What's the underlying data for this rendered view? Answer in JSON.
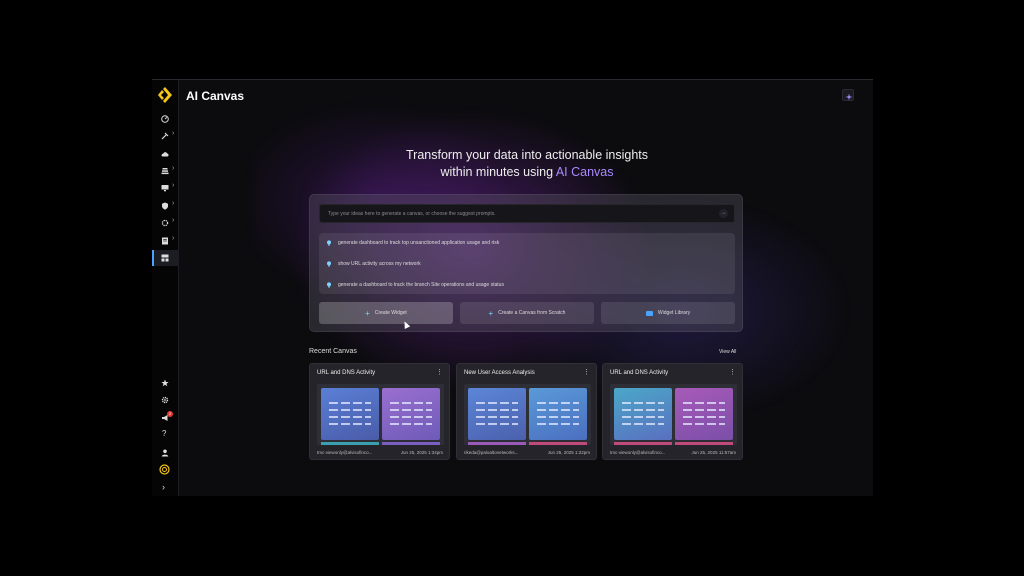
{
  "app": {
    "title": "AI Canvas"
  },
  "hero": {
    "line1": "Transform your data into actionable insights",
    "line2_prefix": "within minutes using ",
    "line2_accent": "AI Canvas"
  },
  "prompt": {
    "placeholder": "Type your ideas here to generate a canvas, or choose the suggest prompts."
  },
  "suggestions": [
    "generate dashboard to track top unsanctioned application usage and risk",
    "show URL activity across my network",
    "generate a dashboard to track the branch Site operations and usage status"
  ],
  "actions": {
    "create_widget": "Create Widget",
    "create_canvas": "Create a Canvas from Scratch",
    "widget_library": "Widget Library"
  },
  "recent": {
    "title": "Recent Canvas",
    "view_all": "View All",
    "cards": [
      {
        "title": "URL and DNS Activity",
        "owner": "tmc-viewonly@alvisofinco...",
        "date": "Jun 25, 2025 1:34pm"
      },
      {
        "title": "New User Access Analysis",
        "owner": "rikeda@paloaltonetworks...",
        "date": "Jun 25, 2025 1:22pm"
      },
      {
        "title": "URL and DNS Activity",
        "owner": "tmc-viewonly@alvisofinco...",
        "date": "Jun 25, 2025 11:57am"
      }
    ]
  },
  "sidebar": {
    "notification_count": "2"
  },
  "colors": {
    "accent": "#a98bff",
    "active_nav": "#4aa3ff",
    "logo": "#f5c518"
  }
}
